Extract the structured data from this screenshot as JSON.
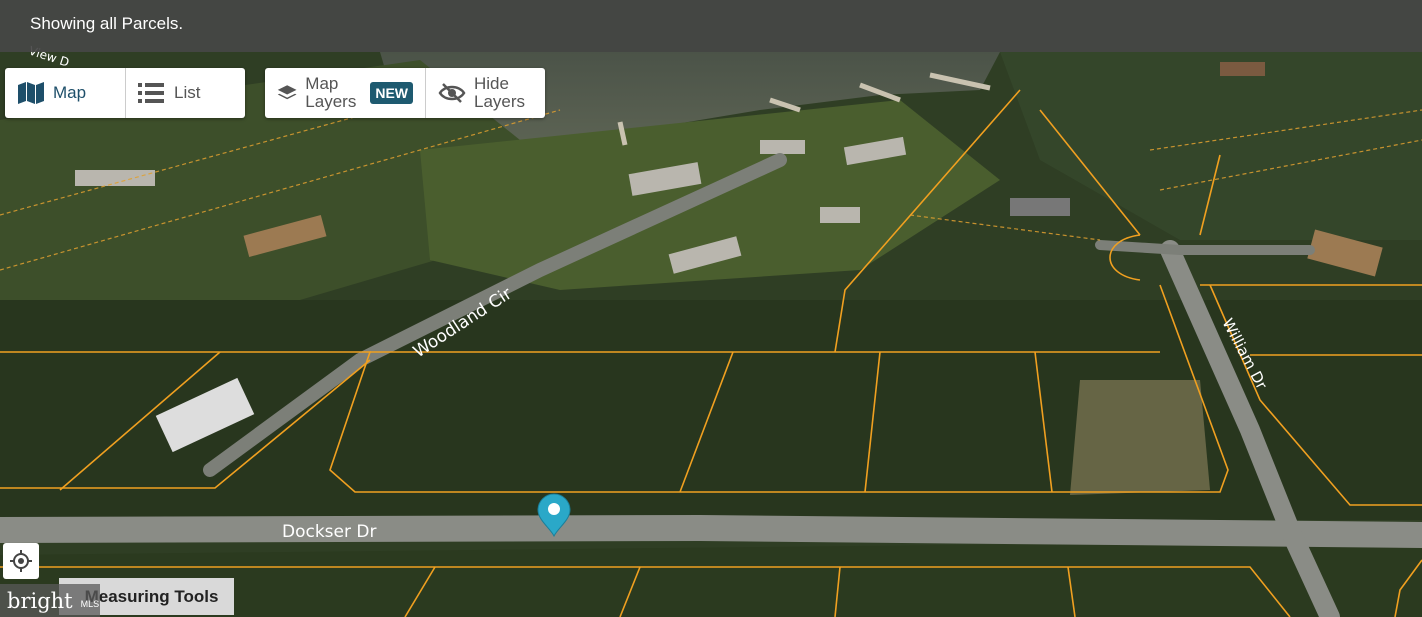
{
  "topbar": {
    "message": "Showing all Parcels."
  },
  "view_toggle": {
    "map_label": "Map",
    "list_label": "List"
  },
  "layers": {
    "map_layers_line1": "Map",
    "map_layers_line2": "Layers",
    "new_badge": "NEW",
    "hide_layers_line1": "Hide",
    "hide_layers_line2": "Layers"
  },
  "streets": {
    "woodland": "Woodland Cir",
    "dockser": "Dockser Dr",
    "william": "William Dr",
    "view_partial": "View D"
  },
  "tools": {
    "measuring_label": "Measuring Tools"
  },
  "logo": {
    "brand": "bright",
    "suffix": "MLS"
  },
  "colors": {
    "parcel_line": "#f0a020",
    "marker": "#2aa8c8",
    "badge": "#1e5a70"
  }
}
